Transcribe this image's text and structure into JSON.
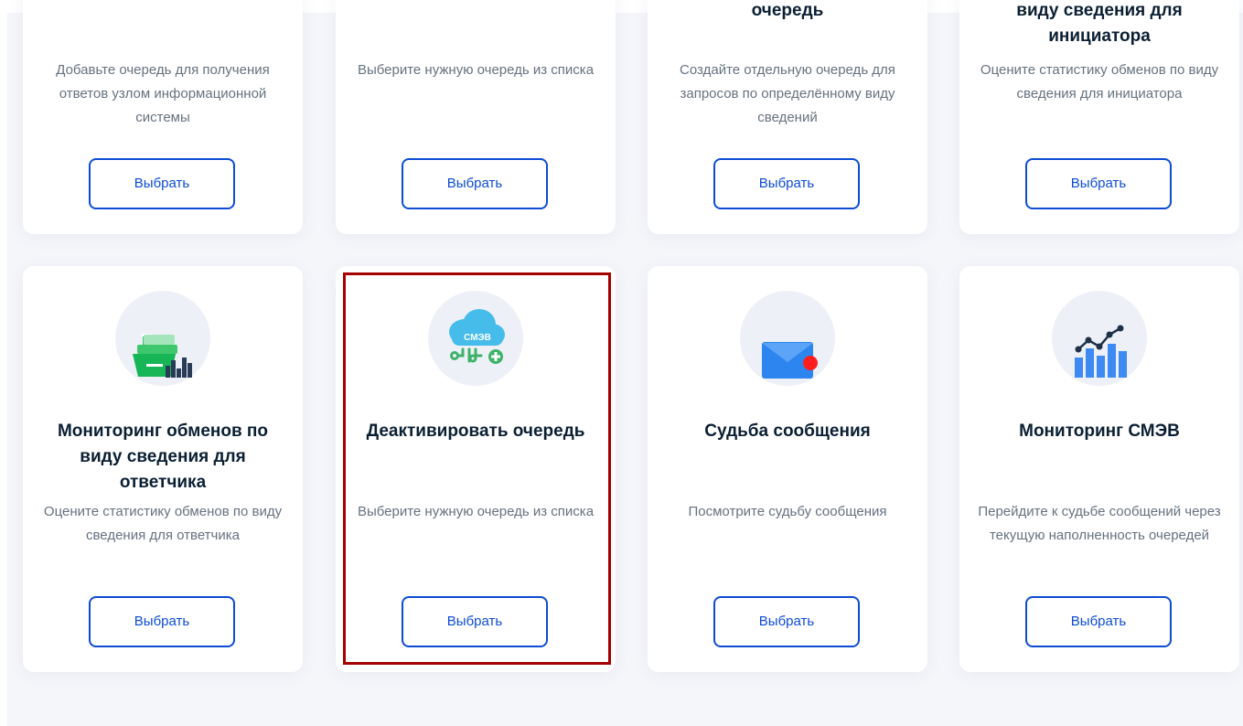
{
  "cards_top": [
    {
      "title": "",
      "description": "Добавьте очередь для получения ответов узлом информационной системы",
      "button": "Выбрать"
    },
    {
      "title": "",
      "description": "Выберите нужную очередь из списка",
      "button": "Выбрать"
    },
    {
      "title": "очередь",
      "description": "Создайте отдельную очередь для запросов по определённому виду сведений",
      "button": "Выбрать"
    },
    {
      "title": "виду сведения для инициатора",
      "description": "Оцените статистику обменов по виду сведения для инициатора",
      "button": "Выбрать"
    }
  ],
  "cards_bottom": [
    {
      "icon": "green-queue-chart-icon",
      "title": "Мониторинг обменов по виду сведения для ответчика",
      "description": "Оцените статистику обменов по виду сведения для ответчика",
      "button": "Выбрать"
    },
    {
      "icon": "smev-cloud-add-icon",
      "icon_text": "СМЭВ",
      "title": "Деактивировать очередь",
      "description": "Выберите нужную очередь из списка",
      "button": "Выбрать",
      "highlighted": true
    },
    {
      "icon": "envelope-notification-icon",
      "title": "Судьба сообщения",
      "description": "Посмотрите судьбу сообщения",
      "button": "Выбрать"
    },
    {
      "icon": "line-bar-chart-icon",
      "title": "Мониторинг СМЭВ",
      "description": "Перейдите к судьбе сообщений через текущую наполненность очередей",
      "button": "Выбрать"
    }
  ],
  "colors": {
    "accent": "#0d4cd3",
    "title": "#0b1f33",
    "description": "#66727f",
    "background": "#f5f6fa",
    "highlight": "#a50000"
  }
}
